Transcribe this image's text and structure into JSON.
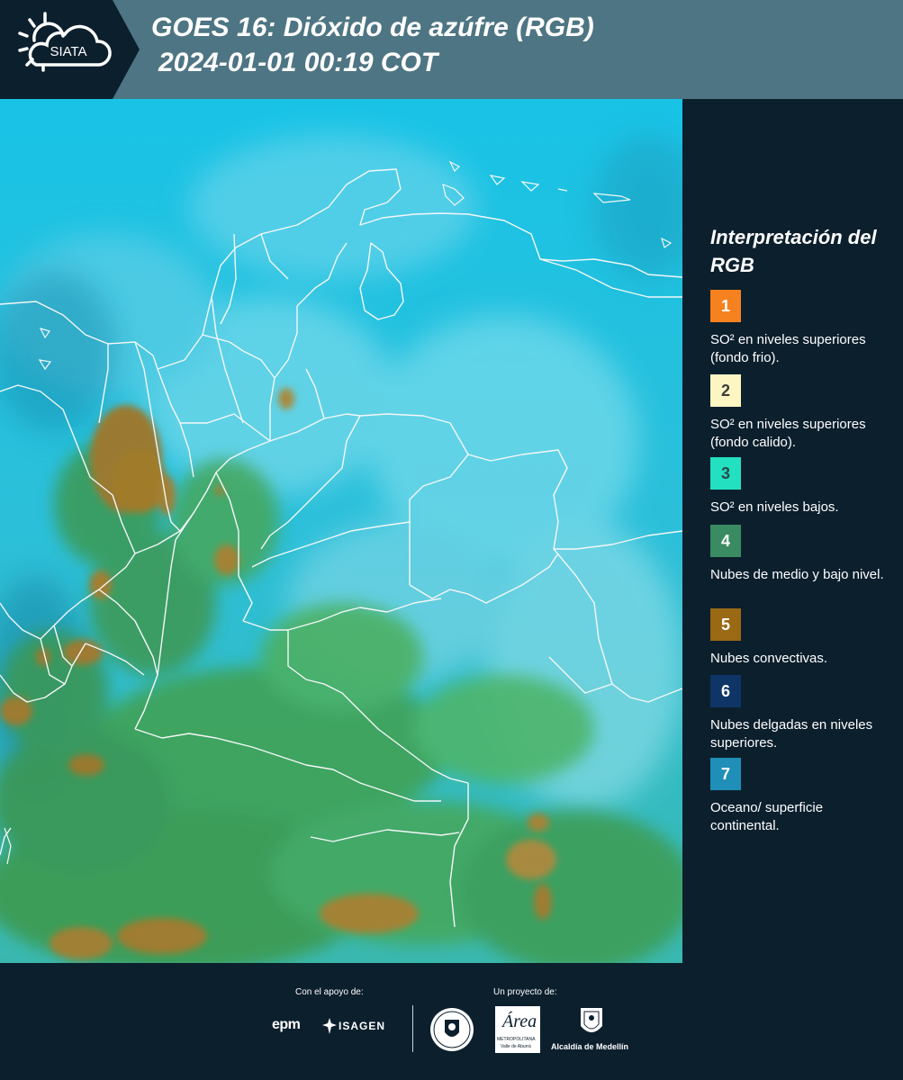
{
  "header": {
    "logo_text": "SIATA",
    "title_line1": "GOES 16: Dióxido de azúfre (RGB)",
    "title_line2": "2024-01-01 00:19 COT"
  },
  "legend": {
    "title": "Interpretación del RGB",
    "items": [
      {
        "number": "1",
        "label": "SO² en niveles superiores (fondo frio).",
        "color": "#f5821f",
        "num_color": "#ffffff"
      },
      {
        "number": "2",
        "label": "SO² en niveles superiores (fondo calido).",
        "color": "#fdf6c3",
        "num_color": "#3d3d3d"
      },
      {
        "number": "3",
        "label": "SO² en niveles bajos.",
        "color": "#23e0c0",
        "num_color": "#2a4a4a"
      },
      {
        "number": "4",
        "label": "Nubes de medio y bajo nivel.",
        "color": "#3a8a62",
        "num_color": "#ffffff"
      },
      {
        "number": "5",
        "label": "Nubes convectivas.",
        "color": "#9a6914",
        "num_color": "#ffffff"
      },
      {
        "number": "6",
        "label": "Nubes delgadas en niveles superiores.",
        "color": "#0e3566",
        "num_color": "#ffffff"
      },
      {
        "number": "7",
        "label": "Oceano/ superficie continental.",
        "color": "#1f8fb8",
        "num_color": "#ffffff"
      }
    ]
  },
  "footer": {
    "support_label": "Con el apoyo de:",
    "project_label": "Un proyecto de:",
    "logo_epm": "epm",
    "logo_isagen": "ISAGEN",
    "logo_area_title": "Área",
    "logo_area_sub1": "METROPOLITANA",
    "logo_area_sub2": "Valle de Aburrá",
    "logo_medellin": "MEDELLÍN",
    "logo_alcaldia": "Alcaldía de Medellín"
  },
  "colors": {
    "header_bg": "#4e7583",
    "panel_bg": "#0c1f2d",
    "sky_cyan": "#1fc6e6",
    "cloud_green": "#3fa256",
    "convective_brown": "#9c7a2a"
  }
}
